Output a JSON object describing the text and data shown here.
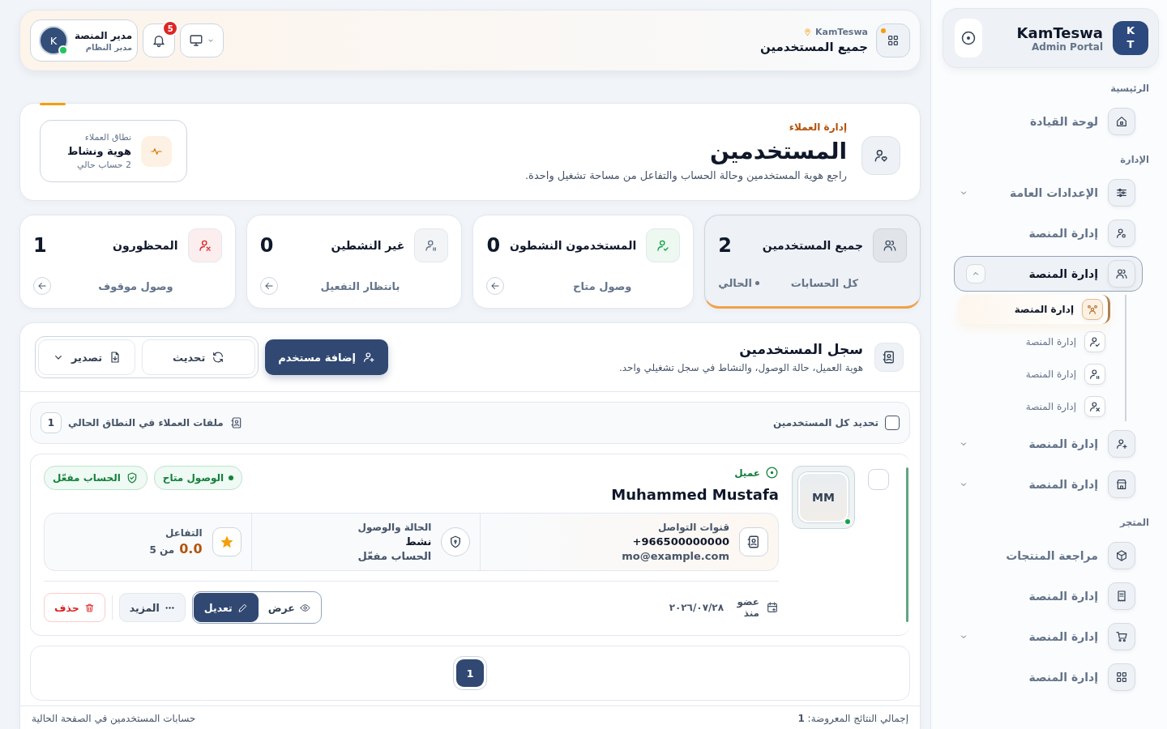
{
  "sidebar": {
    "brand": {
      "initials": "KT",
      "title": "KamTeswa",
      "subtitle": "Admin Portal"
    },
    "sections": [
      {
        "label": "الرئيسية",
        "items": [
          {
            "label": "لوحة القيادة",
            "kind": "home",
            "selected": false
          }
        ]
      },
      {
        "label": "الإدارة",
        "items": [
          {
            "label": "الإعدادات العامة",
            "kind": "sliders",
            "selected": false,
            "expanded": false
          },
          {
            "label": "إدارة المنصة",
            "kind": "user-gear",
            "selected": false
          },
          {
            "label": "إدارة المنصة",
            "kind": "users",
            "selected": true,
            "expanded": true,
            "children": [
              {
                "label": "إدارة المنصة",
                "kind": "group",
                "selected": true
              },
              {
                "label": "إدارة المنصة",
                "kind": "user-check",
                "selected": false
              },
              {
                "label": "إدارة المنصة",
                "kind": "user-pause",
                "selected": false
              },
              {
                "label": "إدارة المنصة",
                "kind": "user-x",
                "selected": false
              }
            ]
          },
          {
            "label": "إدارة المنصة",
            "kind": "user-plus",
            "selected": false,
            "expanded": false
          },
          {
            "label": "إدارة المنصة",
            "kind": "store",
            "selected": false,
            "expanded": false
          }
        ]
      },
      {
        "label": "المتجر",
        "items": [
          {
            "label": "مراجعة المنتجات",
            "kind": "box",
            "selected": false
          },
          {
            "label": "إدارة المنصة",
            "kind": "receipt",
            "selected": false
          },
          {
            "label": "إدارة المنصة",
            "kind": "cart",
            "selected": false,
            "expanded": false
          },
          {
            "label": "إدارة المنصة",
            "kind": "grid",
            "selected": false
          }
        ]
      }
    ]
  },
  "topbar": {
    "breadcrumb": "KamTeswa",
    "title": "جميع المستخدمين",
    "notifications": "5",
    "user": {
      "name": "مدير المنصة",
      "role": "مدير النظام",
      "initial": "K",
      "online": true
    }
  },
  "header": {
    "eyebrow": "إدارة العملاء",
    "title": "المستخدمين",
    "description": "راجع هوية المستخدمين وحالة الحساب والتفاعل من مساحة تشغيل واحدة.",
    "scope": {
      "label": "نطاق العملاء",
      "value": "هوية ونشاط",
      "note": "2 حساب حالي"
    }
  },
  "stats": [
    {
      "title": "جميع المستخدمين",
      "value": "2",
      "caption": "كل الحسابات",
      "tag": "الحالي",
      "kind": "users",
      "color": "#475569",
      "selected": true
    },
    {
      "title": "المستخدمون النشطون",
      "value": "0",
      "caption": "وصول متاح",
      "kind": "user-check",
      "color": "#16a34a",
      "selected": false
    },
    {
      "title": "غير النشطين",
      "value": "0",
      "caption": "بانتظار التفعيل",
      "kind": "user-pause",
      "color": "#64748b",
      "selected": false
    },
    {
      "title": "المحظورون",
      "value": "1",
      "caption": "وصول موقوف",
      "kind": "user-x",
      "color": "#dc2626",
      "selected": false
    }
  ],
  "registry": {
    "title": "سجل المستخدمين",
    "subtitle": "هوية العميل، حالة الوصول، والنشاط في سجل تشغيلي واحد.",
    "add": "إضافة مستخدم",
    "refresh": "تحديث",
    "export": "تصدير",
    "select_all": {
      "label": "تحديد كل المستخدمين",
      "checked": false
    },
    "scope_label": "ملفات العملاء في النطاق الحالي",
    "scope_count": "1",
    "users": [
      {
        "checked": false,
        "initials": "MM",
        "online": true,
        "role": "عميل",
        "name": "Muhammed Mustafa",
        "badges": [
          {
            "label": "الوصول متاح",
            "kind": "dot"
          },
          {
            "label": "الحساب مفعّل",
            "kind": "shield"
          }
        ],
        "contact": {
          "label": "قنوات التواصل",
          "phone": "+966500000000",
          "email": "mo@example.com"
        },
        "status": {
          "label": "الحالة والوصول",
          "value": "نشط",
          "note": "الحساب مفعّل"
        },
        "engagement": {
          "label": "التفاعل",
          "score": "0.0",
          "scale": "من 5"
        },
        "member_label": "عضو منذ",
        "member_date": "٢٠٢٦/٠٧/٢٨",
        "actions": {
          "view": "عرض",
          "edit": "تعديل",
          "more": "المزيد",
          "delete": "حذف"
        }
      }
    ],
    "pages": [
      {
        "label": "1",
        "selected": true
      }
    ]
  },
  "footer": {
    "total_label": "إجمالي النتائج المعروضة:",
    "total": "1",
    "note": "حسابات المستخدمين في الصفحة الحالية"
  }
}
